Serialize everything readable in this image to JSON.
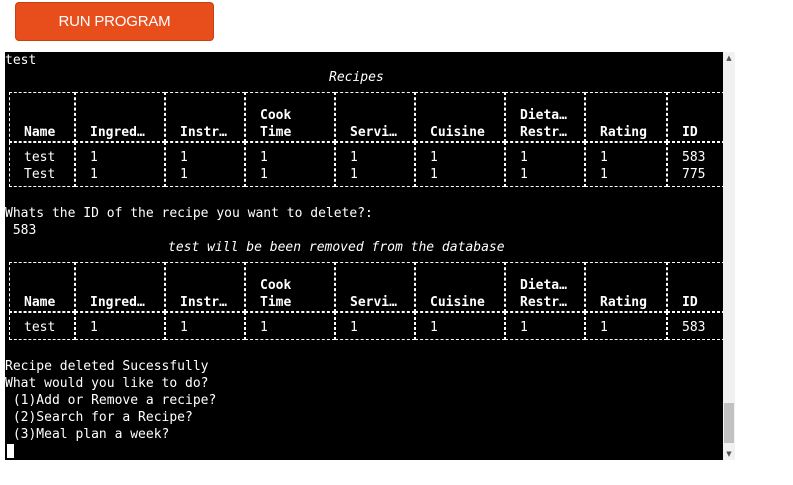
{
  "button": {
    "label": "RUN PROGRAM"
  },
  "terminal": {
    "lines_before": [
      "test"
    ],
    "table1_title": "Recipes",
    "headers": [
      {
        "l1": "",
        "l2": "Name"
      },
      {
        "l1": "",
        "l2": "Ingred…"
      },
      {
        "l1": "",
        "l2": "Instr…"
      },
      {
        "l1": "Cook",
        "l2": "Time"
      },
      {
        "l1": "",
        "l2": "Servi…"
      },
      {
        "l1": "",
        "l2": "Cuisine"
      },
      {
        "l1": "Dieta…",
        "l2": "Restr…"
      },
      {
        "l1": "",
        "l2": "Rating"
      },
      {
        "l1": "",
        "l2": "ID"
      }
    ],
    "table1_rows": [
      [
        "test",
        "1",
        "1",
        "1",
        "1",
        "1",
        "1",
        "1",
        "583"
      ],
      [
        "Test",
        "1",
        "1",
        "1",
        "1",
        "1",
        "1",
        "1",
        "775"
      ]
    ],
    "prompt": "Whats the ID of the recipe you want to delete?:",
    "input_value": " 583",
    "table2_title": "test will be been removed from the database",
    "table2_rows": [
      [
        "test",
        "1",
        "1",
        "1",
        "1",
        "1",
        "1",
        "1",
        "583"
      ]
    ],
    "result": "Recipe deleted Sucessfully",
    "menu_question": "What would you like to do?",
    "menu_options": [
      " (1)Add or Remove a recipe?",
      " (2)Search for a Recipe?",
      " (3)Meal plan a week?"
    ]
  }
}
